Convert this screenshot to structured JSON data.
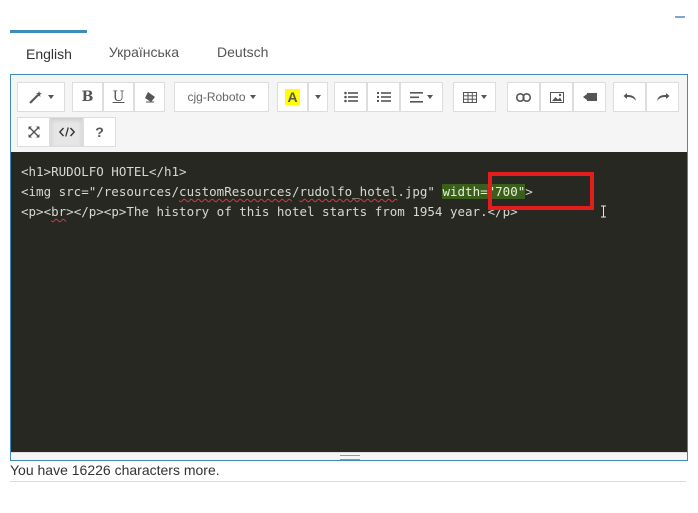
{
  "tabs": [
    {
      "label": "English",
      "active": true
    },
    {
      "label": "Українська",
      "active": false
    },
    {
      "label": "Deutsch",
      "active": false
    }
  ],
  "toolbar": {
    "bold_label": "B",
    "underline_label": "U",
    "font_name": "cjg-Roboto",
    "color_label": "A",
    "help_label": "?",
    "highlight_color": "#ffff00"
  },
  "code": {
    "line1": "<h1>RUDOLFO HOTEL</h1>",
    "line2_a": "<img src=\"/resources/",
    "line2_b": "customResources",
    "line2_c": "/",
    "line2_d": "rudolfo_hotel",
    "line2_e": ".jpg\" ",
    "line2_hl": "width=\"700\"",
    "line2_end": ">",
    "line3_a": "<p><",
    "line3_b": "br",
    "line3_c": "></p><p>The history of this hotel starts from 1954 year.</p>"
  },
  "status": {
    "text": "You have 16226 characters more."
  },
  "colors": {
    "accent": "#3c8dbc",
    "code_bg": "#272822",
    "highlight_box": "#e31d1d"
  }
}
